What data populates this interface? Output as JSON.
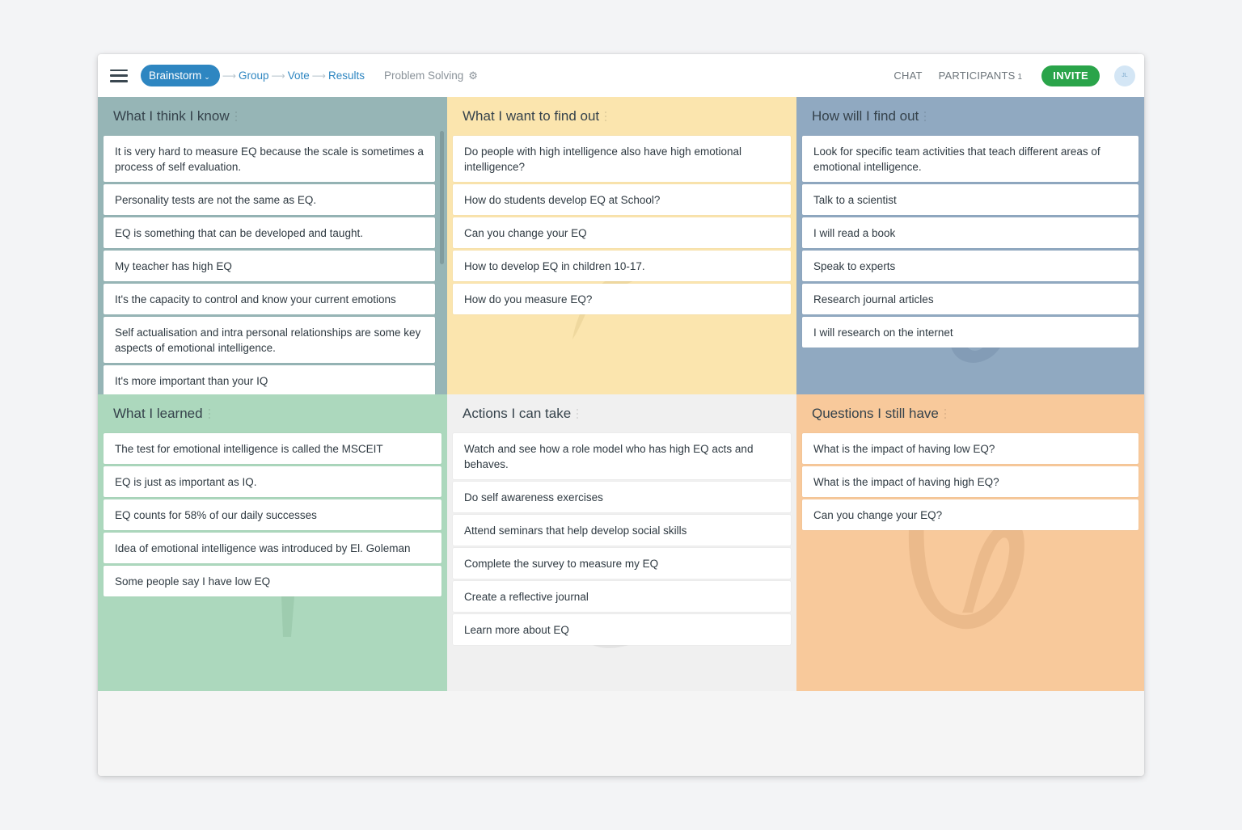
{
  "topbar": {
    "menu_icon": "hamburger-icon",
    "phase_pill": "Brainstorm",
    "steps": [
      "Group",
      "Vote",
      "Results"
    ],
    "board_name": "Problem Solving",
    "settings_icon": "gear-icon",
    "chat_label": "CHAT",
    "participants_label": "PARTICIPANTS",
    "participants_count": "1",
    "invite_label": "INVITE",
    "avatar_initials": "JL"
  },
  "colors": {
    "accent_blue": "#2e86c1",
    "invite_green": "#2aa44a",
    "panel_know": "#96b5b6",
    "panel_find": "#fbe5ae",
    "panel_how": "#90a9c1",
    "panel_learned": "#acd8bd",
    "panel_actions": "#f0f0f0",
    "panel_questions": "#f8c99b"
  },
  "panels": [
    {
      "title": "What I think I know",
      "cards": [
        "It is very hard to measure EQ because the scale is sometimes a process of self evaluation.",
        "Personality tests are not the same as EQ.",
        "EQ is something that can be developed and taught.",
        "My teacher has high EQ",
        "It's the capacity to control and know your current emotions",
        "Self actualisation and intra personal relationships are some key aspects of emotional intelligence.",
        "It's more important than your IQ"
      ]
    },
    {
      "title": "What I want to find out",
      "cards": [
        "Do people with high intelligence also have high emotional intelligence?",
        "How do students develop EQ at School?",
        "Can you change your EQ",
        "How to develop EQ in children 10-17.",
        "How do you measure EQ?"
      ]
    },
    {
      "title": "How will I find out",
      "cards": [
        "Look for specific team activities that teach different areas of emotional intelligence.",
        "Talk to a scientist",
        "I will read a book",
        "Speak to experts",
        "Research journal articles",
        "I will research on the internet"
      ]
    },
    {
      "title": "What I learned",
      "cards": [
        "The test for emotional intelligence is called the MSCEIT",
        "EQ is just as important as IQ.",
        "EQ counts for 58% of our daily successes",
        "Idea of emotional intelligence was introduced by El. Goleman",
        "Some people say I have low EQ"
      ]
    },
    {
      "title": "Actions I can take",
      "cards": [
        "Watch and see how a role model who has high EQ acts and behaves.",
        "Do self awareness exercises",
        "Attend seminars that help develop social skills",
        "Complete the survey to measure my EQ",
        "Create a reflective journal",
        "Learn more about EQ"
      ]
    },
    {
      "title": "Questions I still have",
      "cards": [
        "What is the impact of having low EQ?",
        "What is the impact of having high EQ?",
        "Can you change your EQ?"
      ]
    }
  ]
}
